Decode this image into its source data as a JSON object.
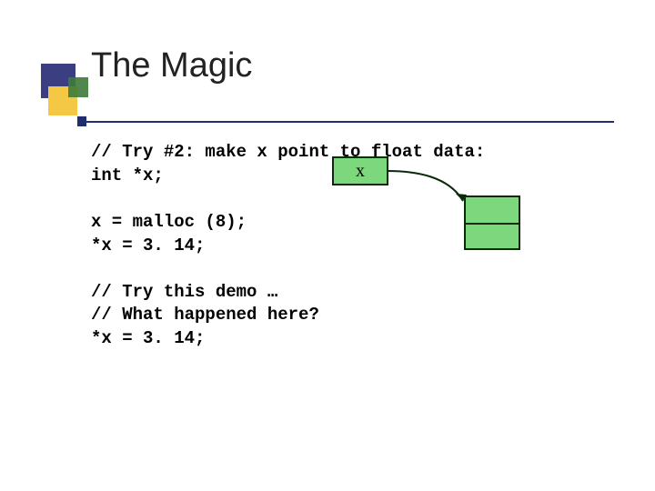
{
  "title": "The Magic",
  "code": {
    "l1": "// Try #2: make x point to float data:",
    "l2": "int *x;",
    "l3": "",
    "l4": "x = malloc (8);",
    "l5": "*x = 3. 14;",
    "l6": "",
    "l7": "// Try this demo …",
    "l8": "// What happened here?",
    "l9": "*x = 3. 14;"
  },
  "diagram": {
    "var_label": "x"
  }
}
